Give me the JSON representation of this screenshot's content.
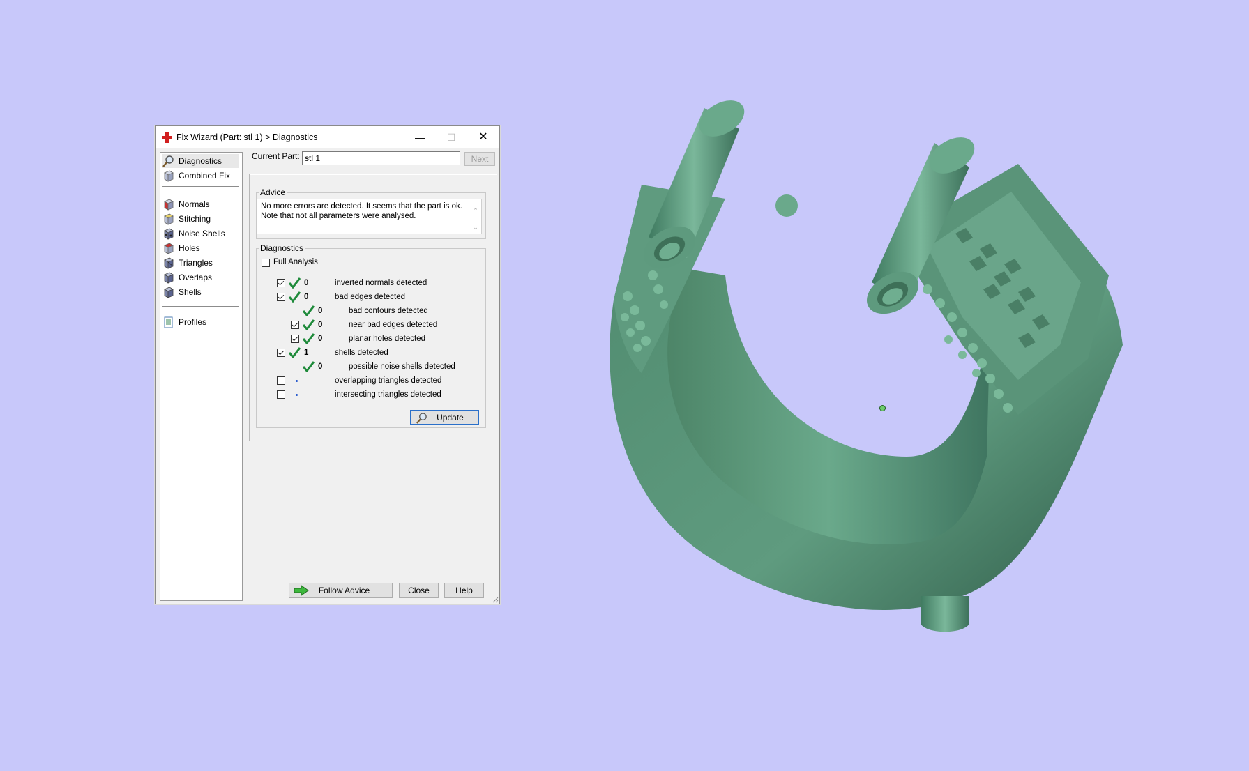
{
  "window": {
    "title": "Fix Wizard (Part: stl 1) > Diagnostics",
    "minimize": "—",
    "maximize": "☐",
    "close": "✕"
  },
  "sidebar": {
    "items": [
      {
        "label": "Diagnostics",
        "icon": "magnifier-icon"
      },
      {
        "label": "Combined Fix",
        "icon": "cube-icon"
      },
      {
        "label": "Normals",
        "icon": "normals-cube-icon"
      },
      {
        "label": "Stitching",
        "icon": "stitching-cube-icon"
      },
      {
        "label": "Noise Shells",
        "icon": "noise-shells-icon"
      },
      {
        "label": "Holes",
        "icon": "holes-cube-icon"
      },
      {
        "label": "Triangles",
        "icon": "triangles-cube-icon"
      },
      {
        "label": "Overlaps",
        "icon": "overlaps-cube-icon"
      },
      {
        "label": "Shells",
        "icon": "shells-cube-icon"
      },
      {
        "label": "Profiles",
        "icon": "profiles-document-icon"
      }
    ]
  },
  "current_part": {
    "label": "Current Part:",
    "value": "stl 1",
    "next_label": "Next"
  },
  "advice": {
    "title": "Advice",
    "text_line1": "No more errors are detected. It seems that the part is ok.",
    "text_line2": "Note that not all parameters were analysed."
  },
  "diagnostics": {
    "title": "Diagnostics",
    "full_analysis_label": "Full Analysis",
    "rows": [
      {
        "count": "0",
        "label": "inverted normals detected"
      },
      {
        "count": "0",
        "label": "bad edges detected"
      },
      {
        "count": "0",
        "label": "bad contours detected"
      },
      {
        "count": "0",
        "label": "near bad edges detected"
      },
      {
        "count": "0",
        "label": "planar holes detected"
      },
      {
        "count": "1",
        "label": "shells detected"
      },
      {
        "count": "0",
        "label": "possible noise shells detected"
      },
      {
        "count": "",
        "label": "overlapping triangles detected"
      },
      {
        "count": "",
        "label": "intersecting triangles detected"
      }
    ],
    "update_label": "Update"
  },
  "footer": {
    "follow_advice_label": "Follow Advice",
    "close_label": "Close",
    "help_label": "Help"
  },
  "colors": {
    "background": "#c8c8fa",
    "model": "#5f9d80",
    "check_green": "#1e8a3a"
  }
}
